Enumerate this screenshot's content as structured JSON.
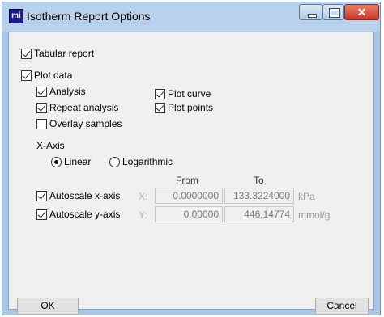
{
  "window": {
    "title": "Isotherm Report Options",
    "app_icon_text": "mi",
    "close_glyph": "✕"
  },
  "options": {
    "tabular_report": {
      "label": "Tabular report",
      "checked": true
    },
    "plot_data": {
      "label": "Plot data",
      "checked": true
    },
    "analysis": {
      "label": "Analysis",
      "checked": true
    },
    "repeat_analysis": {
      "label": "Repeat analysis",
      "checked": true
    },
    "overlay_samples": {
      "label": "Overlay samples",
      "checked": false
    },
    "plot_curve": {
      "label": "Plot curve",
      "checked": true
    },
    "plot_points": {
      "label": "Plot points",
      "checked": true
    }
  },
  "xaxis": {
    "heading": "X-Axis",
    "linear_label": "Linear",
    "log_label": "Logarithmic",
    "selected": "Linear"
  },
  "range": {
    "from_header": "From",
    "to_header": "To",
    "x": {
      "checkbox_label": "Autoscale x-axis",
      "checked": true,
      "axis": "X:",
      "from": "0.0000000",
      "to": "133.3224000",
      "unit": "kPa"
    },
    "y": {
      "checkbox_label": "Autoscale y-axis",
      "checked": true,
      "axis": "Y:",
      "from": "0.00000",
      "to": "446.14774",
      "unit": "mmol/g"
    }
  },
  "buttons": {
    "ok": "OK",
    "cancel": "Cancel"
  }
}
